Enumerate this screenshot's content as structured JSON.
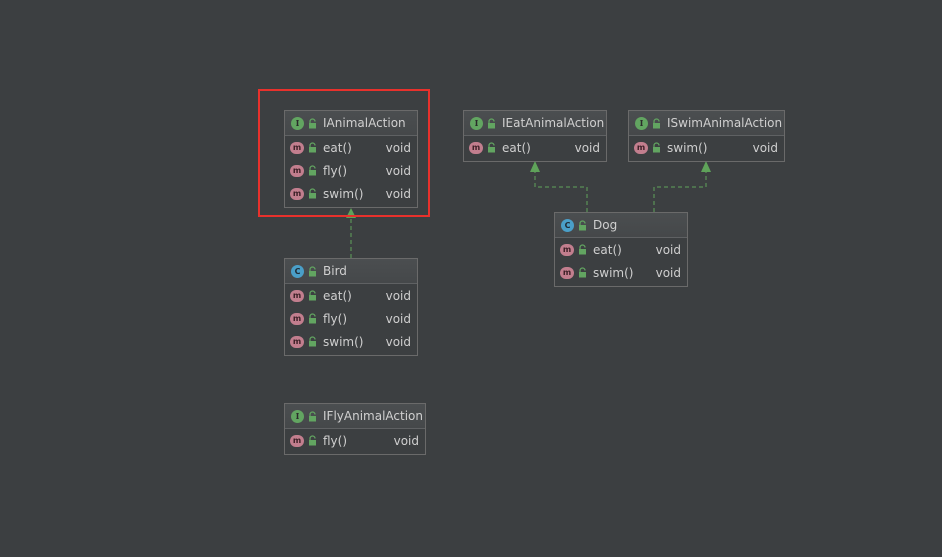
{
  "nodes": {
    "ianimalaction": {
      "kind_glyph": "I",
      "title": "IAnimalAction",
      "methods": [
        {
          "glyph": "m",
          "name": "eat()",
          "type": "void"
        },
        {
          "glyph": "m",
          "name": "fly()",
          "type": "void"
        },
        {
          "glyph": "m",
          "name": "swim()",
          "type": "void"
        }
      ]
    },
    "ieatanimalaction": {
      "kind_glyph": "I",
      "title": "IEatAnimalAction",
      "methods": [
        {
          "glyph": "m",
          "name": "eat()",
          "type": "void"
        }
      ]
    },
    "iswimanimalaction": {
      "kind_glyph": "I",
      "title": "ISwimAnimalAction",
      "methods": [
        {
          "glyph": "m",
          "name": "swim()",
          "type": "void"
        }
      ]
    },
    "dog": {
      "kind_glyph": "C",
      "title": "Dog",
      "methods": [
        {
          "glyph": "m",
          "name": "eat()",
          "type": "void"
        },
        {
          "glyph": "m",
          "name": "swim()",
          "type": "void"
        }
      ]
    },
    "bird": {
      "kind_glyph": "C",
      "title": "Bird",
      "methods": [
        {
          "glyph": "m",
          "name": "eat()",
          "type": "void"
        },
        {
          "glyph": "m",
          "name": "fly()",
          "type": "void"
        },
        {
          "glyph": "m",
          "name": "swim()",
          "type": "void"
        }
      ]
    },
    "iflyanimalaction": {
      "kind_glyph": "I",
      "title": "IFlyAnimalAction",
      "methods": [
        {
          "glyph": "m",
          "name": "fly()",
          "type": "void"
        }
      ]
    }
  },
  "colors": {
    "background": "#3c3f41",
    "interface_badge": "#62a561",
    "class_badge": "#4a9fc8",
    "method_badge": "#c27e8e",
    "realization_arrow": "#5fa35a",
    "highlight_box": "#e8312c"
  },
  "icons": {
    "interface": "interface-icon",
    "class": "class-icon",
    "method": "method-icon",
    "visibility": "public-lock-icon"
  }
}
